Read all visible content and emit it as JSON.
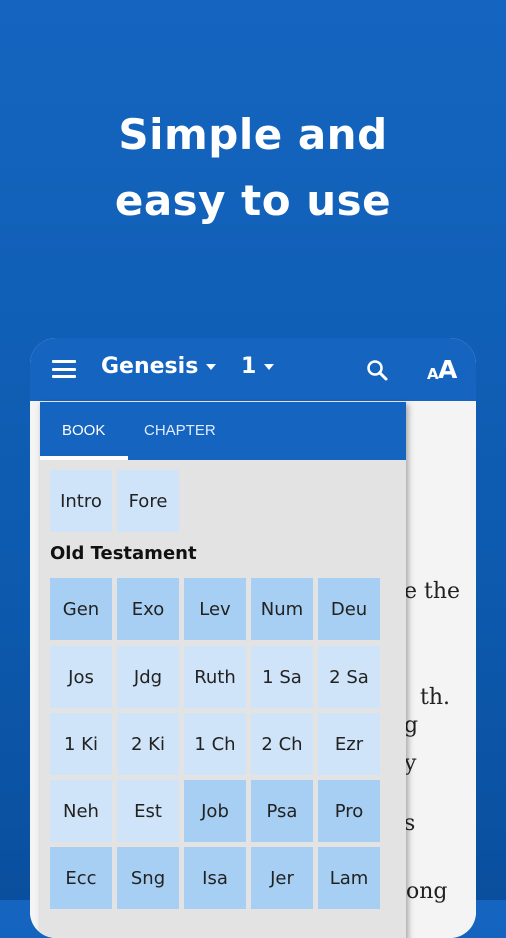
{
  "headline": {
    "line1": "Simple and",
    "line2": "easy to use"
  },
  "appbar": {
    "book": "Genesis",
    "chapter": "1"
  },
  "reader_fragments": [
    "e the",
    "th.",
    "g",
    "y",
    "s",
    "ong"
  ],
  "tabs": {
    "book": "BOOK",
    "chapter": "CHAPTER"
  },
  "intro_items": [
    "Intro",
    "Fore"
  ],
  "old_testament": {
    "title": "Old Testament",
    "rows": [
      [
        "Gen",
        "Exo",
        "Lev",
        "Num",
        "Deu"
      ],
      [
        "Jos",
        "Jdg",
        "Ruth",
        "1 Sa",
        "2 Sa"
      ],
      [
        "1 Ki",
        "2 Ki",
        "1 Ch",
        "2 Ch",
        "Ezr"
      ],
      [
        "Neh",
        "Est",
        "Job",
        "Psa",
        "Pro"
      ],
      [
        "Ecc",
        "Sng",
        "Isa",
        "Jer",
        "Lam"
      ]
    ]
  },
  "colors": {
    "primary": "#1565c0",
    "cell_light": "#cfe4f8",
    "cell_dark": "#a6cff3"
  },
  "icons": [
    "menu-icon",
    "dropdown-caret-icon",
    "search-icon",
    "font-size-icon"
  ]
}
